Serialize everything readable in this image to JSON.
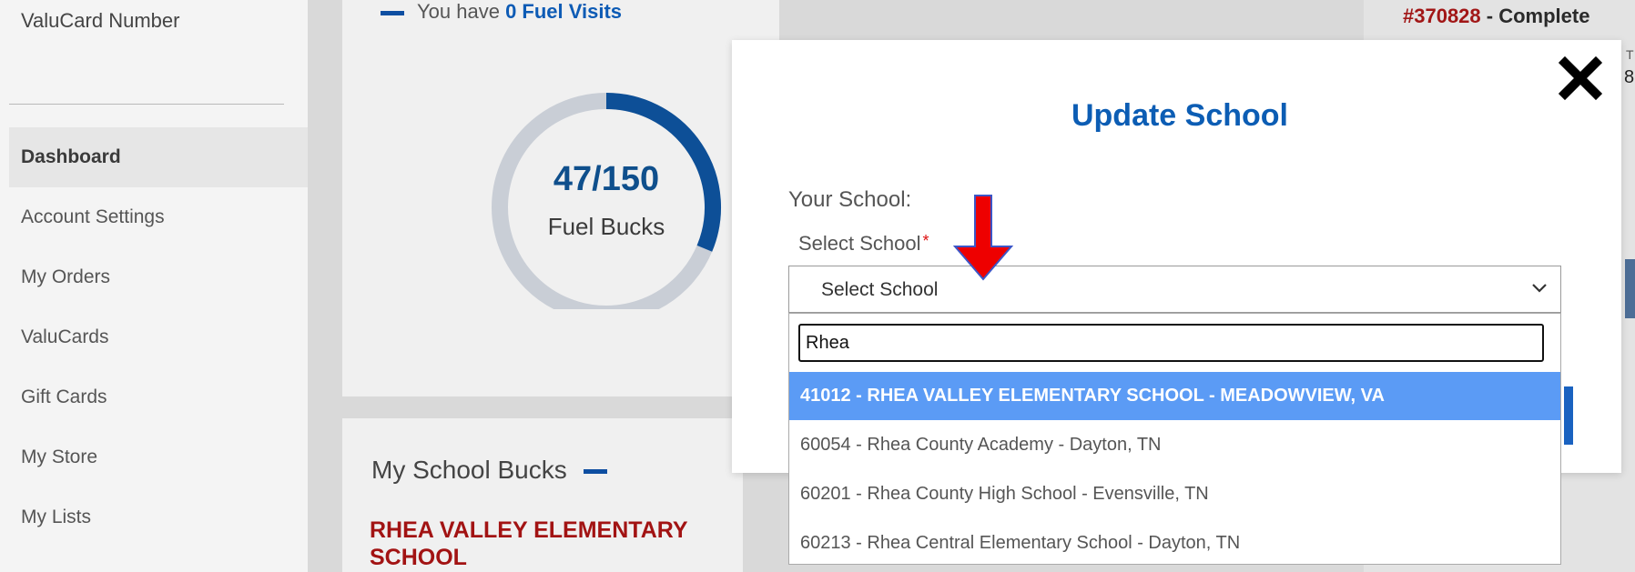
{
  "sidebar": {
    "valucard_label": "ValuCard Number",
    "items": [
      {
        "label": "Dashboard",
        "active": true
      },
      {
        "label": "Account Settings",
        "active": false
      },
      {
        "label": "My Orders",
        "active": false
      },
      {
        "label": "ValuCards",
        "active": false
      },
      {
        "label": "Gift Cards",
        "active": false
      },
      {
        "label": "My Store",
        "active": false
      },
      {
        "label": "My Lists",
        "active": false
      }
    ]
  },
  "fuel": {
    "visits_prefix": "You have ",
    "visits_value": "0 Fuel Visits",
    "progress_text": "47/150",
    "progress_label": "Fuel Bucks",
    "progress_current": 47,
    "progress_max": 150
  },
  "school_bucks": {
    "title": "My School Bucks",
    "school_name": "RHEA VALLEY ELEMENTARY SCHOOL"
  },
  "order": {
    "number": "#370828",
    "separator": " - ",
    "status": "Complete",
    "trunc_1": "T",
    "trunc_2": "8"
  },
  "modal": {
    "title": "Update School",
    "your_school_label": "Your School:",
    "select_label": "Select School",
    "required_mark": "*",
    "select_value": "Select School",
    "search_value": "Rhea",
    "options": [
      {
        "label": "41012 - RHEA VALLEY ELEMENTARY SCHOOL - MEADOWVIEW, VA",
        "highlighted": true
      },
      {
        "label": "60054 - Rhea County Academy - Dayton, TN",
        "highlighted": false
      },
      {
        "label": "60201 - Rhea County High School - Evensville, TN",
        "highlighted": false
      },
      {
        "label": "60213 - Rhea Central Elementary School - Dayton, TN",
        "highlighted": false
      }
    ]
  },
  "colors": {
    "brand_blue": "#0c5db4",
    "accent_red": "#a21313",
    "highlight": "#5b9bf5"
  }
}
